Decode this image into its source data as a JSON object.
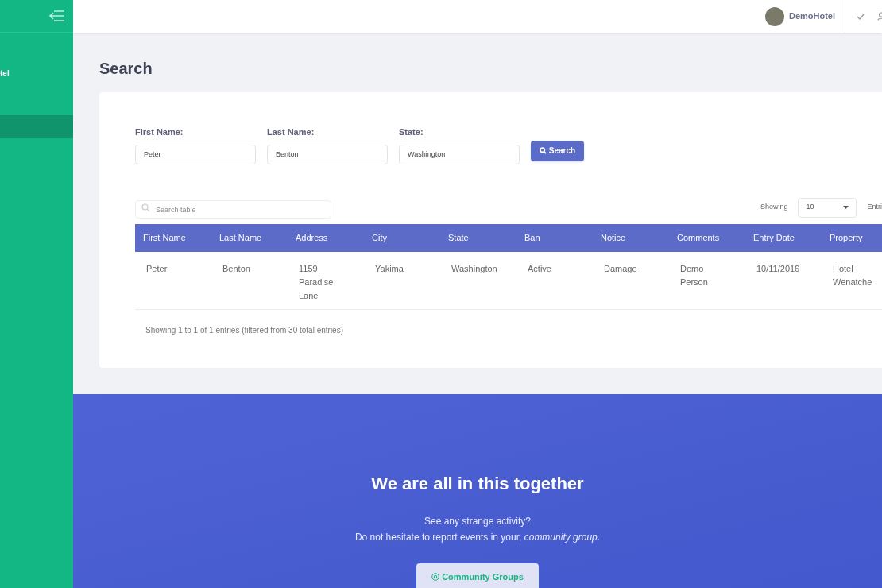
{
  "sidebar": {
    "brand_fragment": "tel",
    "items": [
      {
        "selected": true
      }
    ]
  },
  "topbar": {
    "user": "DemoHotel"
  },
  "page_title": "Search",
  "filters": [
    {
      "label": "First Name:",
      "value": "Peter"
    },
    {
      "label": "Last Name:",
      "value": "Benton"
    },
    {
      "label": "State:",
      "value": "Washington"
    }
  ],
  "search_button": "Search",
  "table_search": {
    "placeholder": "Search table"
  },
  "page_size": {
    "label": "Showing",
    "value": "10",
    "after": "Entri"
  },
  "table": {
    "columns": [
      "First Name",
      "Last Name",
      "Address",
      "City",
      "State",
      "Ban",
      "Notice",
      "Comments",
      "Entry Date",
      "Property"
    ],
    "rows": [
      [
        "Peter",
        "Benton",
        "1159 Paradise Lane",
        "Yakima",
        "Washington",
        "Active",
        "Damage",
        "Demo Person",
        "10/11/2016",
        "Hotel Wenatche"
      ]
    ]
  },
  "table_info": "Showing 1 to 1 of 1 entries (filtered from 30 total entries)",
  "banner": {
    "title": "We are all in this together",
    "line_1": "See any strange activity?",
    "line_2": "Do not hesitate to report events in your, *community group*.",
    "button": "Community Groups"
  }
}
